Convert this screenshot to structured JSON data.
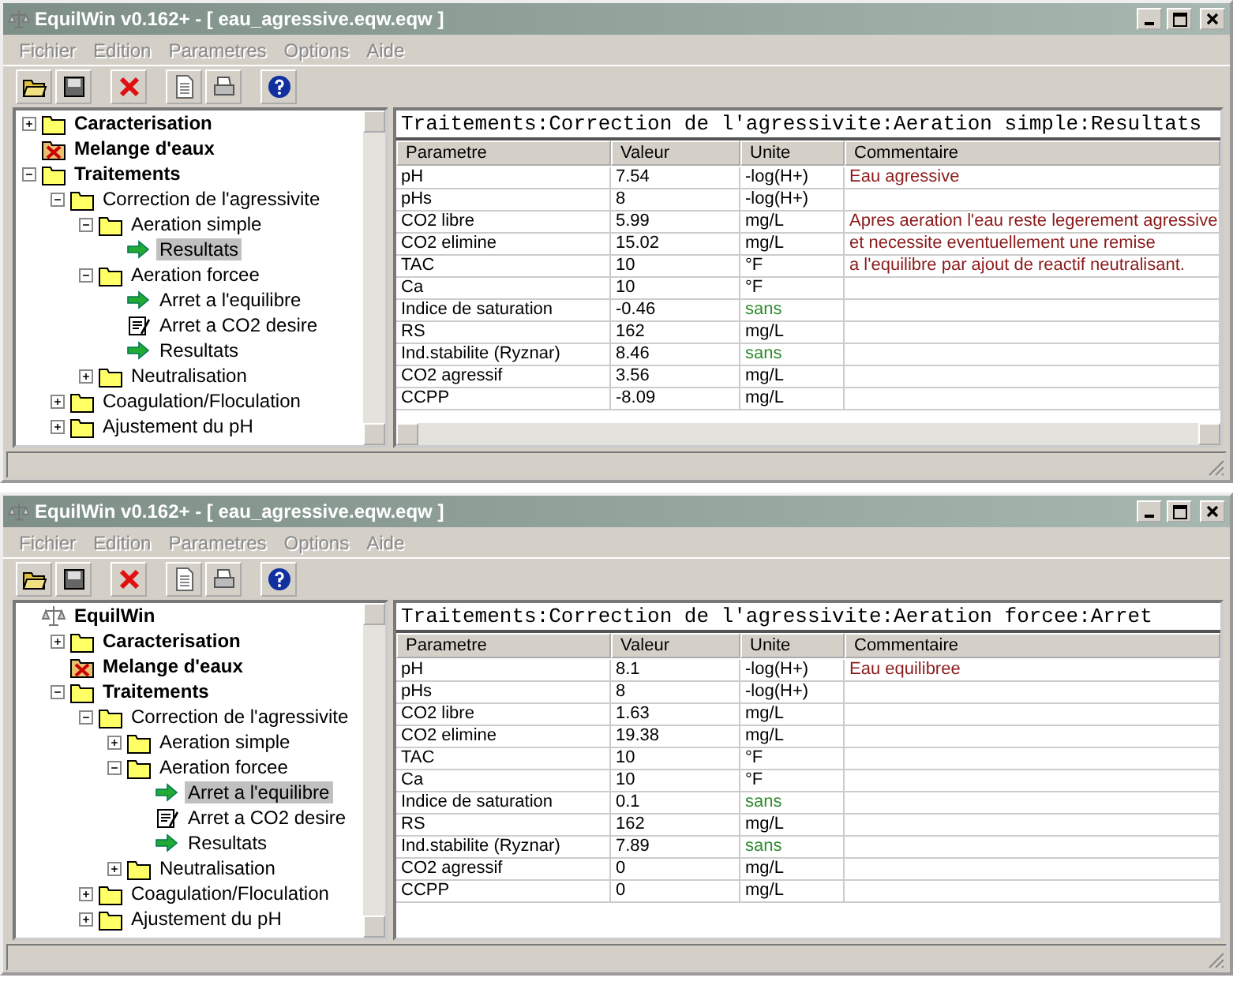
{
  "windows": [
    {
      "title": "EquilWin v0.162+ - [ eau_agressive.eqw.eqw ]",
      "menu": [
        "Fichier",
        "Edition",
        "Parametres",
        "Options",
        "Aide"
      ],
      "tree": [
        {
          "label": "Caracterisation",
          "kind": "folder",
          "bold": true,
          "expanded": false,
          "selected": false
        },
        {
          "label": "Melange d'eaux",
          "kind": "folder-x",
          "bold": true,
          "selected": false
        },
        {
          "label": "Traitements",
          "kind": "folder",
          "bold": true,
          "expanded": true,
          "selected": false,
          "children": [
            {
              "label": "Correction de l'agressivite",
              "kind": "folder",
              "expanded": true,
              "selected": false,
              "children": [
                {
                  "label": "Aeration simple",
                  "kind": "folder",
                  "expanded": true,
                  "selected": false,
                  "children": [
                    {
                      "label": "Resultats",
                      "kind": "arrow",
                      "selected": true
                    }
                  ]
                },
                {
                  "label": "Aeration forcee",
                  "kind": "folder",
                  "expanded": true,
                  "selected": false,
                  "children": [
                    {
                      "label": "Arret a l'equilibre",
                      "kind": "arrow",
                      "selected": false
                    },
                    {
                      "label": "Arret a CO2 desire",
                      "kind": "edit",
                      "selected": false
                    },
                    {
                      "label": "Resultats",
                      "kind": "arrow",
                      "selected": false
                    }
                  ]
                },
                {
                  "label": "Neutralisation",
                  "kind": "folder",
                  "expanded": false,
                  "selected": false
                }
              ]
            },
            {
              "label": "Coagulation/Floculation",
              "kind": "folder",
              "expanded": false,
              "selected": false
            },
            {
              "label": "Ajustement du pH",
              "kind": "folder",
              "expanded": false,
              "selected": false
            }
          ]
        }
      ],
      "path": "Traitements:Correction de l'agressivite:Aeration simple:Resultats",
      "horizontal_scrollbar": true,
      "columns": [
        "Parametre",
        "Valeur",
        "Unite",
        "Commentaire"
      ],
      "rows": [
        {
          "parametre": "pH",
          "valeur": "7.54",
          "unite": {
            "text": "-log(H+)",
            "color": "#000000"
          },
          "commentaire": "Eau agressive"
        },
        {
          "parametre": "pHs",
          "valeur": "8",
          "unite": {
            "text": "-log(H+)",
            "color": "#000000"
          }
        },
        {
          "parametre": "CO2 libre",
          "valeur": "5.99",
          "unite": {
            "text": "mg/L",
            "color": "#000000"
          },
          "commentaire": "Apres aeration l'eau reste legerement agressive"
        },
        {
          "parametre": "CO2 elimine",
          "valeur": "15.02",
          "unite": {
            "text": "mg/L",
            "color": "#000000"
          },
          "commentaire": "et necessite eventuellement une remise"
        },
        {
          "parametre": "TAC",
          "valeur": "10",
          "unite": {
            "text": "°F",
            "color": "#000000"
          },
          "commentaire": "a l'equilibre par ajout de reactif neutralisant."
        },
        {
          "parametre": "Ca",
          "valeur": "10",
          "unite": {
            "text": "°F",
            "color": "#000000"
          }
        },
        {
          "parametre": "Indice de saturation",
          "valeur": "-0.46",
          "unite": {
            "text": "sans",
            "color": "#2e8b2e"
          }
        },
        {
          "parametre": "RS",
          "valeur": "162",
          "unite": {
            "text": "mg/L",
            "color": "#000000"
          }
        },
        {
          "parametre": "Ind.stabilite (Ryznar)",
          "valeur": "8.46",
          "unite": {
            "text": "sans",
            "color": "#2e8b2e"
          }
        },
        {
          "parametre": "CO2 agressif",
          "valeur": "3.56",
          "unite": {
            "text": "mg/L",
            "color": "#000000"
          }
        },
        {
          "parametre": "CCPP",
          "valeur": "-8.09",
          "unite": {
            "text": "mg/L",
            "color": "#000000"
          }
        }
      ]
    },
    {
      "title": "EquilWin v0.162+ - [ eau_agressive.eqw.eqw ]",
      "menu": [
        "Fichier",
        "Edition",
        "Parametres",
        "Options",
        "Aide"
      ],
      "tree": [
        {
          "label": "EquilWin",
          "kind": "app",
          "bold": true,
          "selected": false,
          "children": [
            {
              "label": "Caracterisation",
              "kind": "folder",
              "bold": true,
              "expanded": false,
              "selected": false
            },
            {
              "label": "Melange d'eaux",
              "kind": "folder-x",
              "bold": true,
              "selected": false
            },
            {
              "label": "Traitements",
              "kind": "folder",
              "bold": true,
              "expanded": true,
              "selected": false,
              "children": [
                {
                  "label": "Correction de l'agressivite",
                  "kind": "folder",
                  "expanded": true,
                  "selected": false,
                  "children": [
                    {
                      "label": "Aeration simple",
                      "kind": "folder",
                      "expanded": false,
                      "selected": false
                    },
                    {
                      "label": "Aeration forcee",
                      "kind": "folder",
                      "expanded": true,
                      "selected": false,
                      "children": [
                        {
                          "label": "Arret a l'equilibre",
                          "kind": "arrow",
                          "selected": true
                        },
                        {
                          "label": "Arret a CO2 desire",
                          "kind": "edit",
                          "selected": false
                        },
                        {
                          "label": "Resultats",
                          "kind": "arrow",
                          "selected": false
                        }
                      ]
                    },
                    {
                      "label": "Neutralisation",
                      "kind": "folder",
                      "expanded": false,
                      "selected": false
                    }
                  ]
                },
                {
                  "label": "Coagulation/Floculation",
                  "kind": "folder",
                  "expanded": false,
                  "selected": false
                },
                {
                  "label": "Ajustement du pH",
                  "kind": "folder",
                  "expanded": false,
                  "selected": false
                }
              ]
            }
          ]
        }
      ],
      "path": "Traitements:Correction de l'agressivite:Aeration forcee:Arret",
      "horizontal_scrollbar": false,
      "columns": [
        "Parametre",
        "Valeur",
        "Unite",
        "Commentaire"
      ],
      "rows": [
        {
          "parametre": "pH",
          "valeur": "8.1",
          "unite": {
            "text": "-log(H+)",
            "color": "#000000"
          },
          "commentaire": "Eau equilibree"
        },
        {
          "parametre": "pHs",
          "valeur": "8",
          "unite": {
            "text": "-log(H+)",
            "color": "#000000"
          }
        },
        {
          "parametre": "CO2 libre",
          "valeur": "1.63",
          "unite": {
            "text": "mg/L",
            "color": "#000000"
          }
        },
        {
          "parametre": "CO2 elimine",
          "valeur": "19.38",
          "unite": {
            "text": "mg/L",
            "color": "#000000"
          }
        },
        {
          "parametre": "TAC",
          "valeur": "10",
          "unite": {
            "text": "°F",
            "color": "#000000"
          }
        },
        {
          "parametre": "Ca",
          "valeur": "10",
          "unite": {
            "text": "°F",
            "color": "#000000"
          }
        },
        {
          "parametre": "Indice de saturation",
          "valeur": "0.1",
          "unite": {
            "text": "sans",
            "color": "#2e8b2e"
          }
        },
        {
          "parametre": "RS",
          "valeur": "162",
          "unite": {
            "text": "mg/L",
            "color": "#000000"
          }
        },
        {
          "parametre": "Ind.stabilite (Ryznar)",
          "valeur": "7.89",
          "unite": {
            "text": "sans",
            "color": "#2e8b2e"
          }
        },
        {
          "parametre": "CO2 agressif",
          "valeur": "0",
          "unite": {
            "text": "mg/L",
            "color": "#000000"
          }
        },
        {
          "parametre": "CCPP",
          "valeur": "0",
          "unite": {
            "text": "mg/L",
            "color": "#000000"
          }
        }
      ]
    }
  ]
}
